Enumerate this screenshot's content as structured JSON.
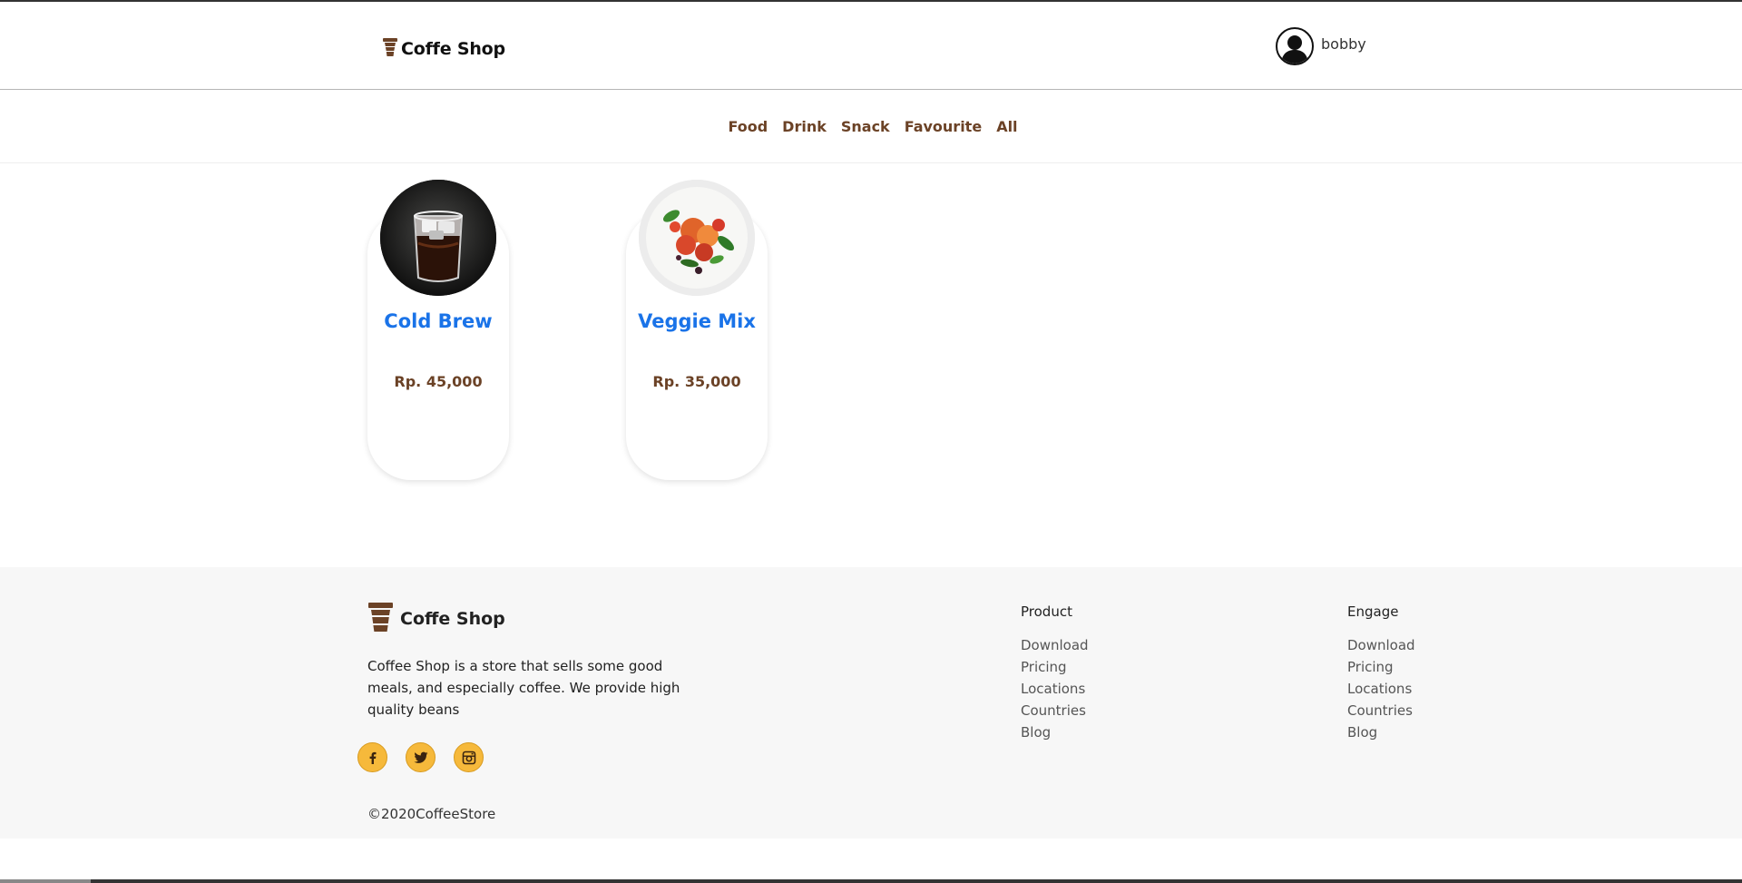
{
  "header": {
    "brand": "Coffe Shop",
    "user_name": "bobby"
  },
  "categories": [
    "Food",
    "Drink",
    "Snack",
    "Favourite",
    "All"
  ],
  "products": [
    {
      "name": "Cold Brew",
      "price": "Rp. 45,000"
    },
    {
      "name": "Veggie Mix",
      "price": "Rp. 35,000"
    }
  ],
  "footer": {
    "brand": "Coffe Shop",
    "description": "Coffee Shop is a store that sells some good meals, and especially coffee. We provide high quality beans",
    "copyright": "©2020CoffeeStore",
    "socials": [
      "facebook-icon",
      "twitter-icon",
      "instagram-icon"
    ],
    "product_column": {
      "title": "Product",
      "links": [
        "Download",
        "Pricing",
        "Locations",
        "Countries",
        "Blog"
      ]
    },
    "engage_column": {
      "title": "Engage",
      "links": [
        "Download",
        "Pricing",
        "Locations",
        "Countries",
        "Blog"
      ]
    }
  },
  "colors": {
    "brand_brown": "#6b4226",
    "product_blue": "#1a73e8",
    "social_yellow": "#f6b93b",
    "footer_bg": "#f7f7f7"
  }
}
